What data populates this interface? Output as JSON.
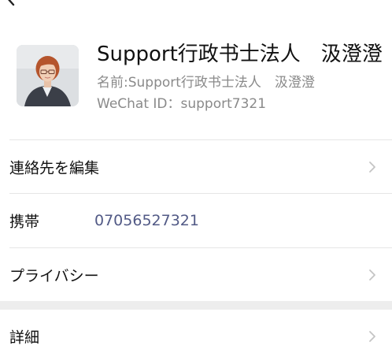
{
  "profile": {
    "display_name": "Support行政书士法人　汲澄澄",
    "name_line": "名前:Support行政书士法人　汲澄澄",
    "wechat_id_line": "WeChat ID：support7321"
  },
  "rows": {
    "edit_contact": {
      "label": "連絡先を編集"
    },
    "mobile": {
      "label": "携帯",
      "value": "07056527321"
    },
    "privacy": {
      "label": "プライバシー"
    },
    "details": {
      "label": "詳細"
    }
  },
  "colors": {
    "link": "#525a86",
    "secondary_text": "#8a8a8a",
    "chevron": "#c4c4c4",
    "section_gap": "#ededed"
  },
  "icons": {
    "back": "chevron-left-icon",
    "row_arrow": "chevron-right-icon"
  }
}
